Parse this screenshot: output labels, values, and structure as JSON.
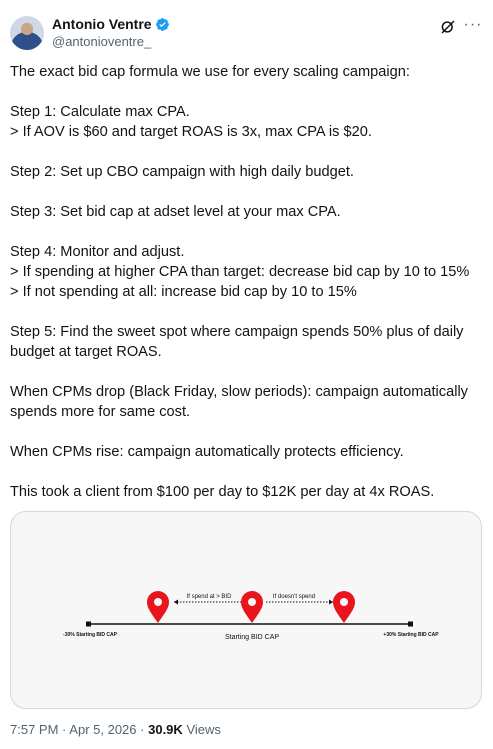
{
  "author": {
    "name": "Antonio Ventre",
    "handle": "@antonioventre_"
  },
  "tweet": {
    "text": "The exact bid cap formula we use for every scaling campaign:\n\nStep 1: Calculate max CPA.\n> If AOV is $60 and target ROAS is 3x, max CPA is $20.\n\nStep 2: Set up CBO campaign with high daily budget.\n\nStep 3: Set bid cap at adset level at your max CPA.\n\nStep 4: Monitor and adjust.\n> If spending at higher CPA than target: decrease bid cap by 10 to 15%\n> If not spending at all: increase bid cap by 10 to 15%\n\nStep 5: Find the sweet spot where campaign spends 50% plus of daily\nbudget at target ROAS.\n\nWhen CPMs drop (Black Friday, slow periods): campaign automatically\nspends more for same cost.\n\nWhen CPMs rise: campaign automatically protects efficiency.\n\nThis took a client from $100 per day to $12K per day at 4x ROAS."
  },
  "diagram": {
    "left_label": "-30% Starting BID CAP",
    "center_label": "Starting BID CAP",
    "right_label": "+30% Starting BID CAP",
    "arrow_left_label": "If spend at > BID",
    "arrow_right_label": "If doesn't spend",
    "pin_color": "#e8161c"
  },
  "meta": {
    "time": "7:57 PM",
    "separator": "·",
    "date": "Apr 5, 2026",
    "views_count": "30.9K",
    "views_label": "Views"
  },
  "icons": {
    "verified": "verified-badge-icon",
    "grok": "grok-icon",
    "more": "more-icon"
  }
}
